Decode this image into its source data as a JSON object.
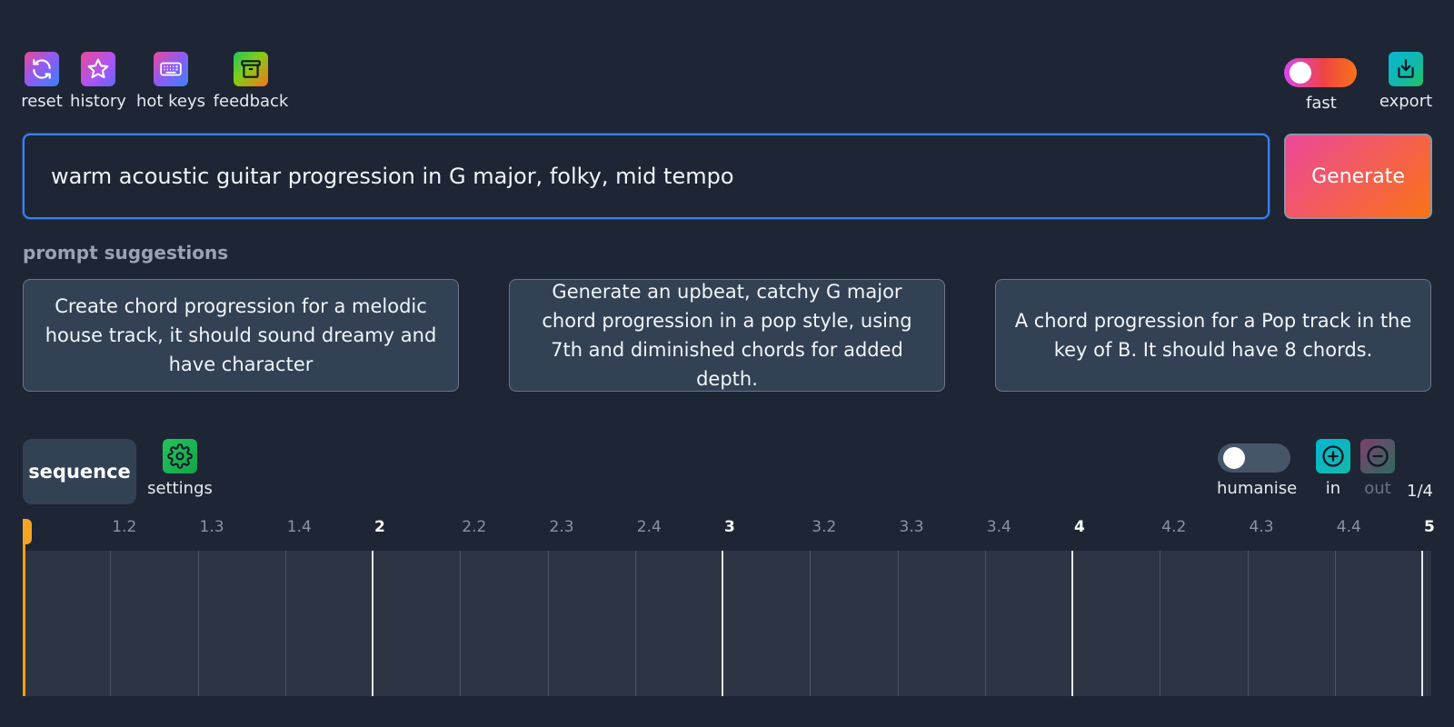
{
  "toolbar": {
    "left": [
      {
        "label": "reset",
        "icon": "refresh-icon"
      },
      {
        "label": "history",
        "icon": "star-icon"
      },
      {
        "label": "hot keys",
        "icon": "keyboard-icon"
      },
      {
        "label": "feedback",
        "icon": "archive-box-icon"
      }
    ],
    "fast": {
      "label": "fast",
      "on": false
    },
    "export": {
      "label": "export",
      "icon": "download-tray-icon"
    }
  },
  "prompt": {
    "value": "warm acoustic guitar progression in G major, folky, mid tempo",
    "generate_label": "Generate"
  },
  "suggestions": {
    "title": "prompt suggestions",
    "items": [
      "Create chord progression for a melodic house track, it should sound dreamy and have character",
      "Generate an upbeat, catchy G major chord progression in a pop style, using 7th and diminished chords for added depth.",
      "A chord progression for a Pop track in the key of B. It should have 8 chords."
    ]
  },
  "sequence": {
    "tab_label": "sequence",
    "settings_label": "settings",
    "humanise": {
      "label": "humanise",
      "on": false
    },
    "zoom_in_label": "in",
    "zoom_out_label": "out",
    "zoom_level": "1/4"
  },
  "timeline": {
    "ticks": [
      "1.2",
      "1.3",
      "1.4",
      "2",
      "2.2",
      "2.3",
      "2.4",
      "3",
      "3.2",
      "3.3",
      "3.4",
      "4",
      "4.2",
      "4.3",
      "4.4",
      "5"
    ],
    "major_ticks": [
      "2",
      "3",
      "4",
      "5"
    ]
  },
  "colors": {
    "background": "#1e2635",
    "accent_blue": "#3b82f6",
    "playhead": "#f59e0b",
    "generate_gradient": [
      "#ec4899",
      "#f97316"
    ]
  }
}
